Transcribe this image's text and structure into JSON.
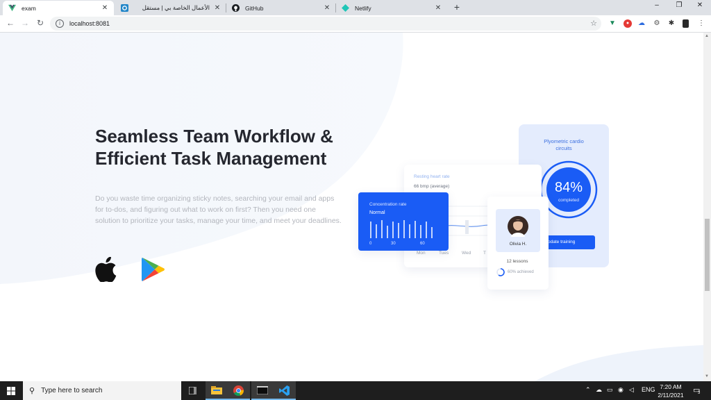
{
  "browser": {
    "tabs": [
      {
        "title": "exam",
        "icon": "vue-icon"
      },
      {
        "title": "الأعمال الخاصة بي | مستقل",
        "icon": "mostaql-icon"
      },
      {
        "title": "GitHub",
        "icon": "github-icon"
      },
      {
        "title": "Netlify",
        "icon": "netlify-icon"
      }
    ],
    "new_tab": "+",
    "url": "localhost:8081",
    "window_controls": {
      "minimize": "–",
      "restore": "❐",
      "close": "✕"
    }
  },
  "hero": {
    "title_line1": "Seamless Team Workflow &",
    "title_line2": "Efficient Task Management",
    "description": "Do you waste time organizing sticky notes, searching your email and apps for to-dos, and figuring out what to work on first? Then you need one solution to prioritize your tasks, manage your time, and meet your deadlines.",
    "store_icons": [
      "apple-icon",
      "google-play-icon"
    ]
  },
  "illustration": {
    "progress_card": {
      "title_line1": "Plyometric cardio",
      "title_line2": "circuits",
      "percent": "84%",
      "percent_value": 84,
      "status": "completed",
      "button": "pdate training"
    },
    "heart_card": {
      "title": "Resting heart rate",
      "value": "66 bmp (average)",
      "days": [
        "Mon",
        "Tues",
        "Wed",
        "T"
      ]
    },
    "concentration_card": {
      "title": "Concentration rate",
      "level": "Normal",
      "ticks": [
        "0",
        "30",
        "60"
      ]
    },
    "profile_card": {
      "name": "Olivia H.",
      "lessons": "12 lessons",
      "achieved": "60% achieved",
      "achieved_value": 60
    }
  },
  "taskbar": {
    "search_placeholder": "Type here to search",
    "language": "ENG",
    "time": "7:20 AM",
    "date": "2/11/2021",
    "notification_count": "3"
  },
  "colors": {
    "accent": "#1a5cf5",
    "card_bg": "#e3ecfd",
    "title": "#25272f",
    "muted": "#b3b6bd"
  }
}
